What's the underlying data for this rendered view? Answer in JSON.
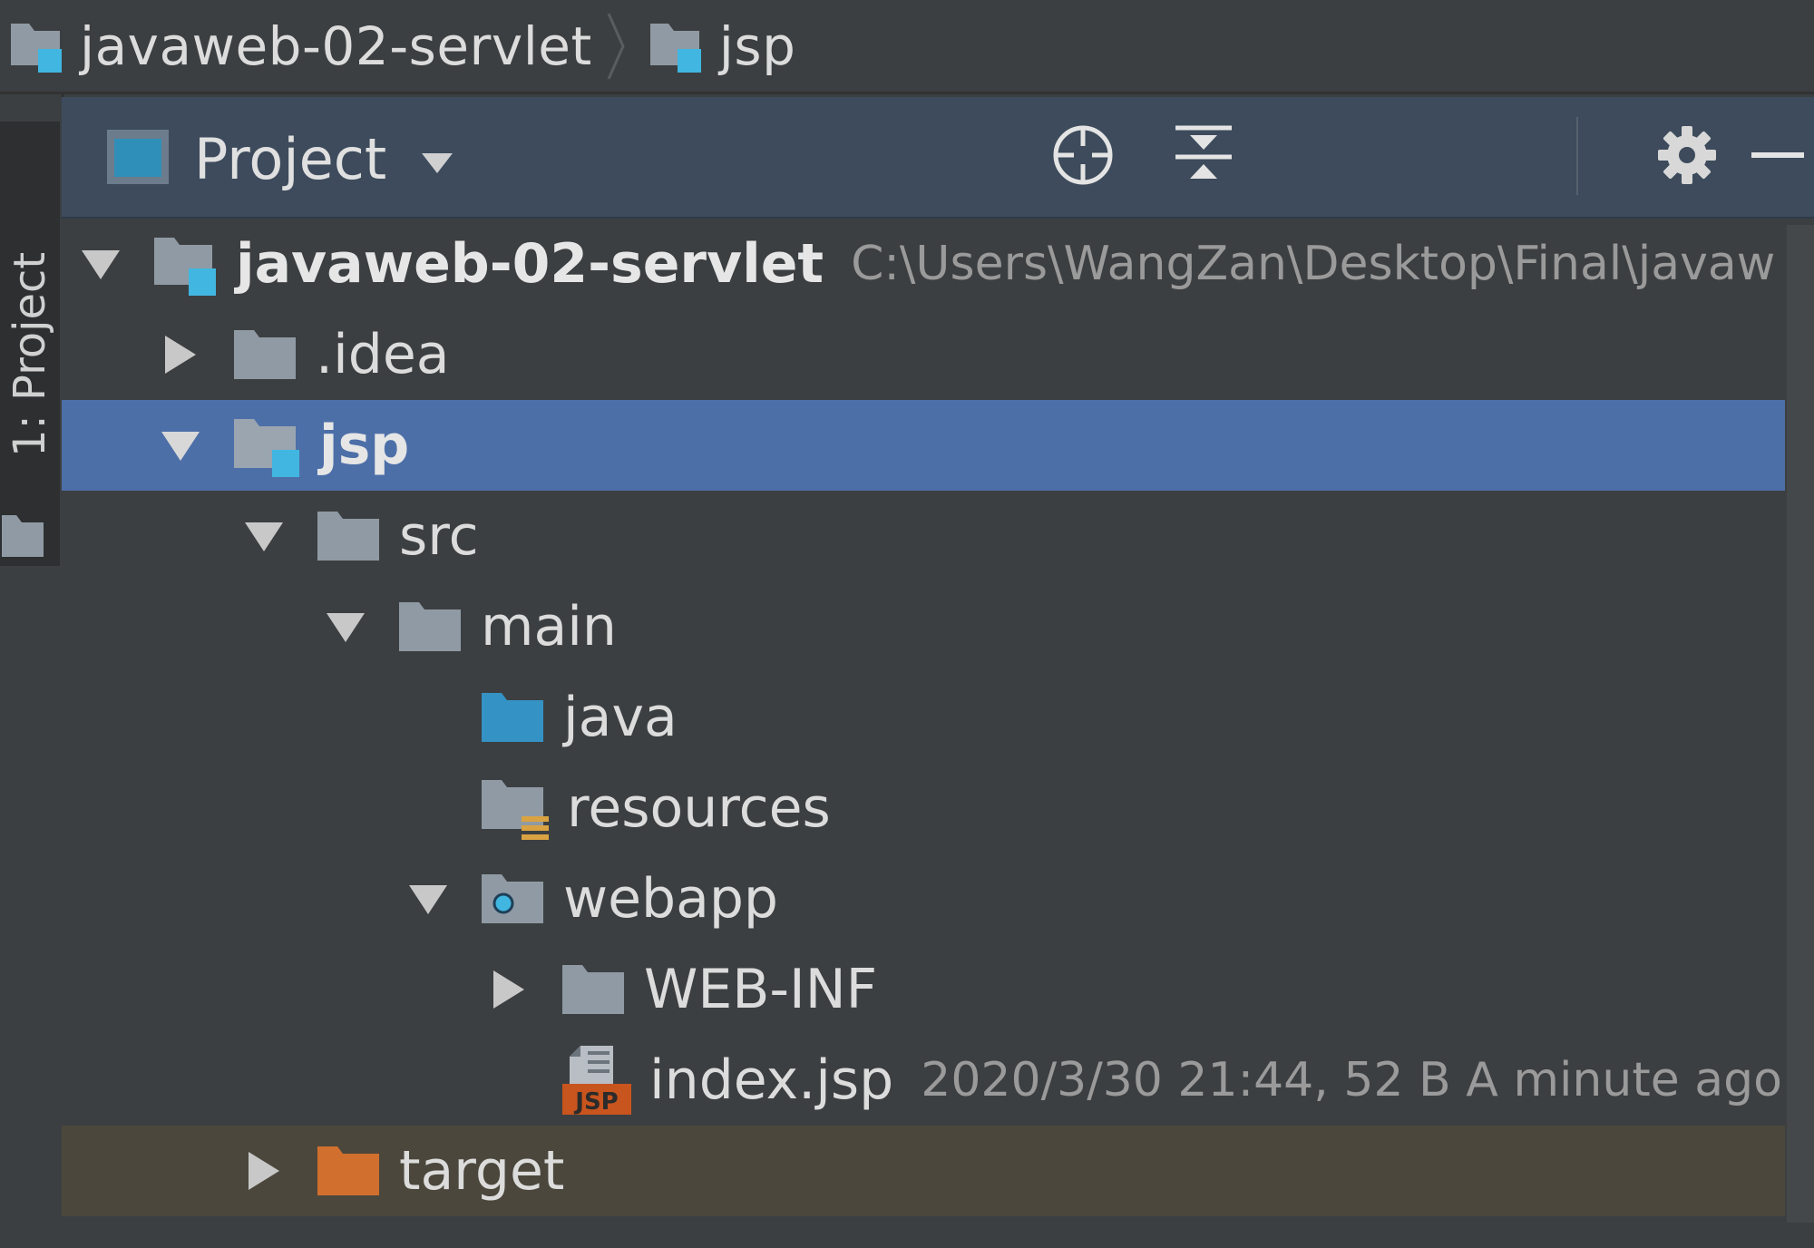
{
  "breadcrumb": {
    "items": [
      {
        "label": "javaweb-02-servlet",
        "icon": "module-folder-icon"
      },
      {
        "label": "jsp",
        "icon": "module-folder-icon"
      }
    ]
  },
  "left_strip": {
    "tab_label": "1: Project"
  },
  "tool_window": {
    "title": "Project",
    "buttons": [
      "locate-icon",
      "collapse-all-icon",
      "gear-icon",
      "minimize-icon"
    ]
  },
  "tree": {
    "rows": [
      {
        "label": "javaweb-02-servlet",
        "meta": "C:\\Users\\WangZan\\Desktop\\Final\\javaw",
        "expanded": true,
        "bold": true
      },
      {
        "label": ".idea",
        "meta": "",
        "expanded": false
      },
      {
        "label": "jsp",
        "meta": "",
        "expanded": true,
        "bold": true,
        "selected": true
      },
      {
        "label": "src",
        "meta": "",
        "expanded": true
      },
      {
        "label": "main",
        "meta": "",
        "expanded": true
      },
      {
        "label": "java",
        "meta": ""
      },
      {
        "label": "resources",
        "meta": ""
      },
      {
        "label": "webapp",
        "meta": "",
        "expanded": true
      },
      {
        "label": "WEB-INF",
        "meta": "",
        "expanded": false
      },
      {
        "label": "index.jsp",
        "meta": "2020/3/30 21:44, 52 B A minute ago"
      },
      {
        "label": "target",
        "meta": "",
        "expanded": false
      }
    ]
  },
  "colors": {
    "background": "#3c3f41",
    "header": "#3d4b5c",
    "selection": "#4d6fa8",
    "folder": "#8f9aa4",
    "source_folder": "#3592c4",
    "excluded_folder": "#d06f2e",
    "module_badge": "#40b6e0"
  }
}
